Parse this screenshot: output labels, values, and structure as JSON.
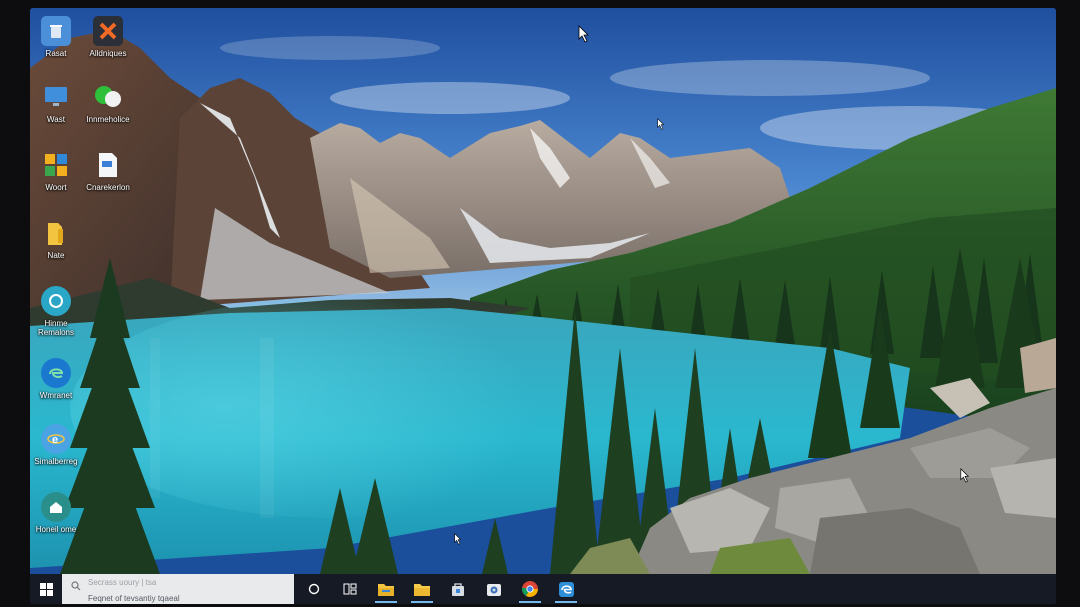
{
  "desktop": {
    "icons": [
      {
        "label": "Rasat",
        "icon": "recycle-bin-icon"
      },
      {
        "label": "Alldniques",
        "icon": "app-orange-icon"
      },
      {
        "label": "Wast",
        "icon": "monitor-icon"
      },
      {
        "label": "Innmeholice",
        "icon": "chat-icon"
      },
      {
        "label": "Woort",
        "icon": "windows-store-icon"
      },
      {
        "label": "Cnarekerlon",
        "icon": "document-icon"
      },
      {
        "label": "Nate",
        "icon": "folder-icon"
      },
      {
        "label": "Hinme Remalons",
        "icon": "remote-icon"
      },
      {
        "label": "Wmranet",
        "icon": "edge-icon"
      },
      {
        "label": "Simalberreg",
        "icon": "internet-explorer-icon"
      },
      {
        "label": "Honeil ome",
        "icon": "home-icon"
      }
    ]
  },
  "taskbar": {
    "search": {
      "line1": "Secrass uoury | tsa",
      "value": "Feqnet of tevsantiy tqaeal"
    },
    "pinned": [
      {
        "name": "cortana",
        "icon": "cortana-circle-icon"
      },
      {
        "name": "task-view",
        "icon": "task-view-icon"
      },
      {
        "name": "file-explorer",
        "icon": "file-explorer-icon"
      },
      {
        "name": "file-explorer-2",
        "icon": "folder-icon"
      },
      {
        "name": "store",
        "icon": "store-bag-icon"
      },
      {
        "name": "camera",
        "icon": "camera-icon"
      },
      {
        "name": "chrome",
        "icon": "chrome-icon"
      },
      {
        "name": "edge",
        "icon": "edge-icon"
      }
    ]
  },
  "colors": {
    "taskbar_bg": "#151a24",
    "accent": "#76b9ed",
    "lake": "#2fb3c9",
    "forest": "#1f4a22",
    "sky": "#2c62b4"
  }
}
